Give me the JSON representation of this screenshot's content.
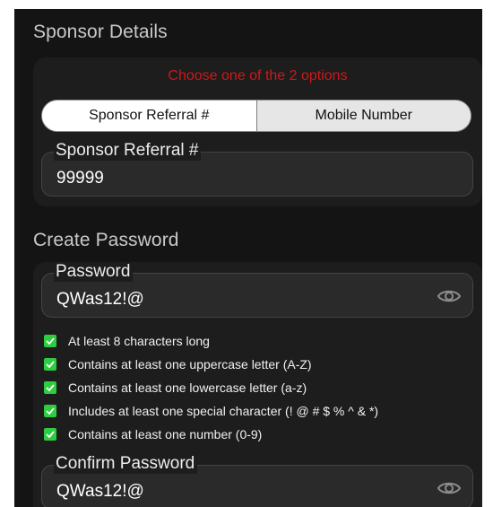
{
  "sponsor": {
    "title": "Sponsor Details",
    "notice": "Choose one of the 2 options",
    "options": [
      "Sponsor Referral #",
      "Mobile Number"
    ],
    "selected_option": "Sponsor Referral #",
    "field_label": "Sponsor Referral #",
    "field_value": "99999"
  },
  "password": {
    "title": "Create Password",
    "password_label": "Password",
    "password_value": "QWas12!@",
    "rules": [
      "At least 8 characters long",
      "Contains at least one uppercase letter (A-Z)",
      "Contains at least one lowercase letter (a-z)",
      "Includes at least one special character (! @ # $ % ^ & *)",
      "Contains at least one number (0-9)"
    ],
    "confirm_label": "Confirm Password",
    "confirm_value": "QWas12!@"
  },
  "icons": {
    "eye": "eye-icon",
    "check": "checkbox-checked-icon"
  },
  "colors": {
    "panel": "#141414",
    "card": "#1d1d1d",
    "notice": "#d01818",
    "check": "#2ecc40"
  }
}
